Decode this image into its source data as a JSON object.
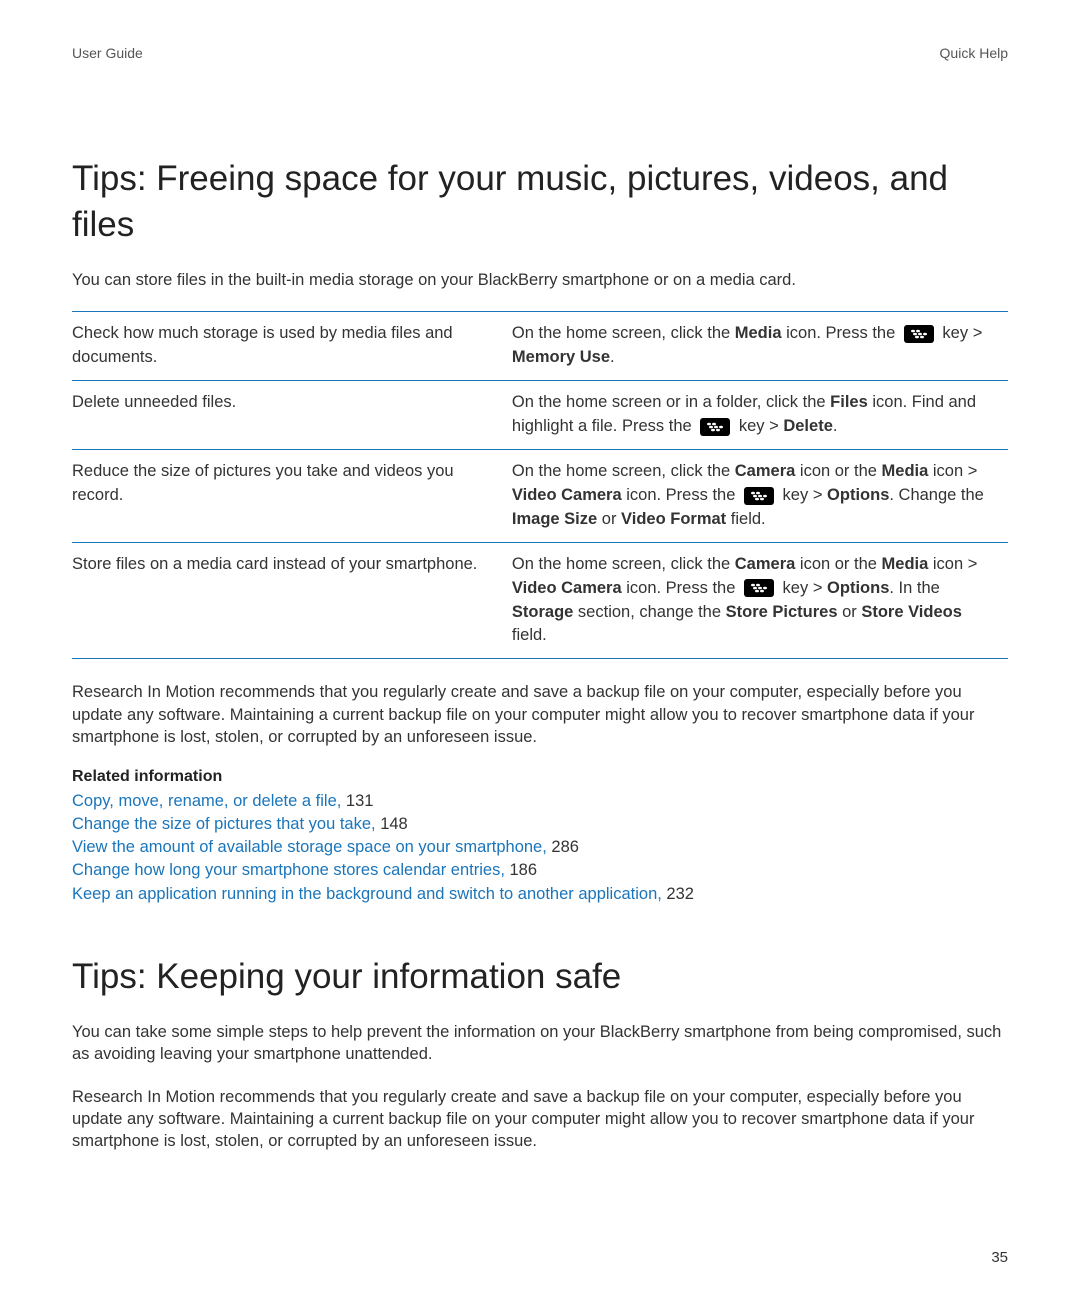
{
  "header": {
    "left": "User Guide",
    "right": "Quick Help"
  },
  "h1": "Tips: Freeing space for your music, pictures, videos, and files",
  "intro": "You can store files in the built-in media storage on your BlackBerry smartphone or on a media card.",
  "rows": [
    {
      "left": "Check how much storage is used by media files and documents.",
      "right": {
        "segs": [
          {
            "t": "On the home screen, click the "
          },
          {
            "t": "Media",
            "b": 1
          },
          {
            "t": " icon. Press the "
          },
          {
            "key": 1
          },
          {
            "t": " key > "
          },
          {
            "t": "Memory Use",
            "b": 1
          },
          {
            "t": "."
          }
        ]
      }
    },
    {
      "left": "Delete unneeded files.",
      "right": {
        "segs": [
          {
            "t": "On the home screen or in a folder, click the "
          },
          {
            "t": "Files",
            "b": 1
          },
          {
            "t": " icon. Find and highlight a file. Press the "
          },
          {
            "key": 1
          },
          {
            "t": " key > "
          },
          {
            "t": "Delete",
            "b": 1
          },
          {
            "t": "."
          }
        ]
      }
    },
    {
      "left": "Reduce the size of pictures you take and videos you record.",
      "right": {
        "segs": [
          {
            "t": "On the home screen, click the "
          },
          {
            "t": "Camera",
            "b": 1
          },
          {
            "t": " icon or the "
          },
          {
            "t": "Media",
            "b": 1
          },
          {
            "t": " icon > "
          },
          {
            "t": "Video Camera",
            "b": 1
          },
          {
            "t": " icon. Press the "
          },
          {
            "key": 1
          },
          {
            "t": " key > "
          },
          {
            "t": "Options",
            "b": 1
          },
          {
            "t": ". Change the "
          },
          {
            "t": "Image Size",
            "b": 1
          },
          {
            "t": " or "
          },
          {
            "t": "Video Format",
            "b": 1
          },
          {
            "t": " field."
          }
        ]
      }
    },
    {
      "left": "Store files on a media card instead of your smartphone.",
      "right": {
        "segs": [
          {
            "t": "On the home screen, click the "
          },
          {
            "t": "Camera",
            "b": 1
          },
          {
            "t": " icon or the "
          },
          {
            "t": "Media",
            "b": 1
          },
          {
            "t": " icon > "
          },
          {
            "t": "Video Camera",
            "b": 1
          },
          {
            "t": " icon. Press the "
          },
          {
            "key": 1
          },
          {
            "t": " key > "
          },
          {
            "t": "Options",
            "b": 1
          },
          {
            "t": ". In the "
          },
          {
            "t": "Storage",
            "b": 1
          },
          {
            "t": " section, change the "
          },
          {
            "t": "Store Pictures",
            "b": 1
          },
          {
            "t": " or "
          },
          {
            "t": "Store Videos",
            "b": 1
          },
          {
            "t": " field."
          }
        ]
      }
    }
  ],
  "backup_note": "Research In Motion recommends that you regularly create and save a backup file on your computer, especially before you update any software. Maintaining a current backup file on your computer might allow you to recover smartphone data if your smartphone is lost, stolen, or corrupted by an unforeseen issue.",
  "related_heading": "Related information",
  "related": [
    {
      "text": "Copy, move, rename, or delete a file,",
      "page": "131"
    },
    {
      "text": "Change the size of pictures that you take,",
      "page": "148"
    },
    {
      "text": "View the amount of available storage space on your smartphone,",
      "page": "286"
    },
    {
      "text": "Change how long your smartphone stores calendar entries,",
      "page": "186"
    },
    {
      "text": "Keep an application running in the background and switch to another application,",
      "page": "232"
    }
  ],
  "h2": "Tips: Keeping your information safe",
  "safe_p1": "You can take some simple steps to help prevent the information on your BlackBerry smartphone from being compromised, such as avoiding leaving your smartphone unattended.",
  "page_number": "35"
}
